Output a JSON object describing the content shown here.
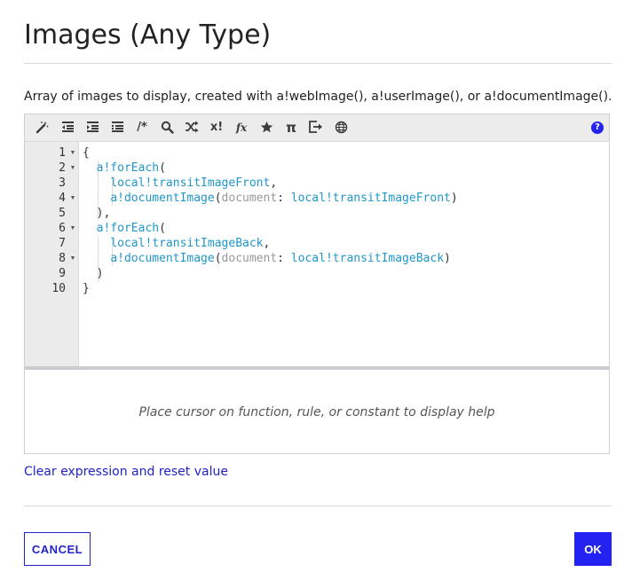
{
  "dialog": {
    "title": "Images (Any Type)",
    "description": "Array of images to display, created with a!webImage(), a!userImage(), or a!documentImage()."
  },
  "toolbar": {
    "tools": [
      "magic-wand-icon",
      "outdent-icon",
      "indent-icon",
      "list-icon",
      "comment-icon",
      "search-icon",
      "shuffle-icon",
      "x-factorial-icon",
      "function-icon",
      "star-icon",
      "pi-icon",
      "export-icon",
      "globe-icon"
    ],
    "comment_glyph": "/*",
    "xfact_glyph": "x!",
    "fx_glyph": "fx",
    "pi_glyph": "π",
    "help_glyph": "?"
  },
  "editor": {
    "line_numbers": [
      "1",
      "2",
      "3",
      "4",
      "5",
      "6",
      "7",
      "8",
      "9",
      "10"
    ],
    "lines": [
      [
        {
          "t": "{",
          "c": "p"
        }
      ],
      [
        {
          "t": "  ",
          "c": "p"
        },
        {
          "t": "a!forEach",
          "c": "fn"
        },
        {
          "t": "(",
          "c": "p"
        }
      ],
      [
        {
          "t": "    ",
          "c": "p"
        },
        {
          "t": "local!transitImageFront",
          "c": "var"
        },
        {
          "t": ",",
          "c": "p"
        }
      ],
      [
        {
          "t": "    ",
          "c": "p"
        },
        {
          "t": "a!documentImage",
          "c": "fn"
        },
        {
          "t": "(",
          "c": "p"
        },
        {
          "t": "document",
          "c": "kw"
        },
        {
          "t": ": ",
          "c": "p"
        },
        {
          "t": "local!transitImageFront",
          "c": "var"
        },
        {
          "t": ")",
          "c": "p"
        }
      ],
      [
        {
          "t": "  ",
          "c": "p"
        },
        {
          "t": "),",
          "c": "p"
        }
      ],
      [
        {
          "t": "  ",
          "c": "p"
        },
        {
          "t": "a!forEach",
          "c": "fn"
        },
        {
          "t": "(",
          "c": "p"
        }
      ],
      [
        {
          "t": "    ",
          "c": "p"
        },
        {
          "t": "local!transitImageBack",
          "c": "var"
        },
        {
          "t": ",",
          "c": "p"
        }
      ],
      [
        {
          "t": "    ",
          "c": "p"
        },
        {
          "t": "a!documentImage",
          "c": "fn"
        },
        {
          "t": "(",
          "c": "p"
        },
        {
          "t": "document",
          "c": "kw"
        },
        {
          "t": ": ",
          "c": "p"
        },
        {
          "t": "local!transitImageBack",
          "c": "var"
        },
        {
          "t": ")",
          "c": "p"
        }
      ],
      [
        {
          "t": "  ",
          "c": "p"
        },
        {
          "t": ")",
          "c": "p"
        }
      ],
      [
        {
          "t": "}",
          "c": "p"
        }
      ]
    ],
    "foldable_lines": [
      1,
      2,
      4,
      6,
      8
    ]
  },
  "help": {
    "placeholder": "Place cursor on function, rule, or constant to display help"
  },
  "actions": {
    "clear_link": "Clear expression and reset value",
    "cancel_label": "CANCEL",
    "ok_label": "OK"
  },
  "colors": {
    "accent": "#2322f0",
    "function": "#1f97c9",
    "keyword": "#999999"
  }
}
